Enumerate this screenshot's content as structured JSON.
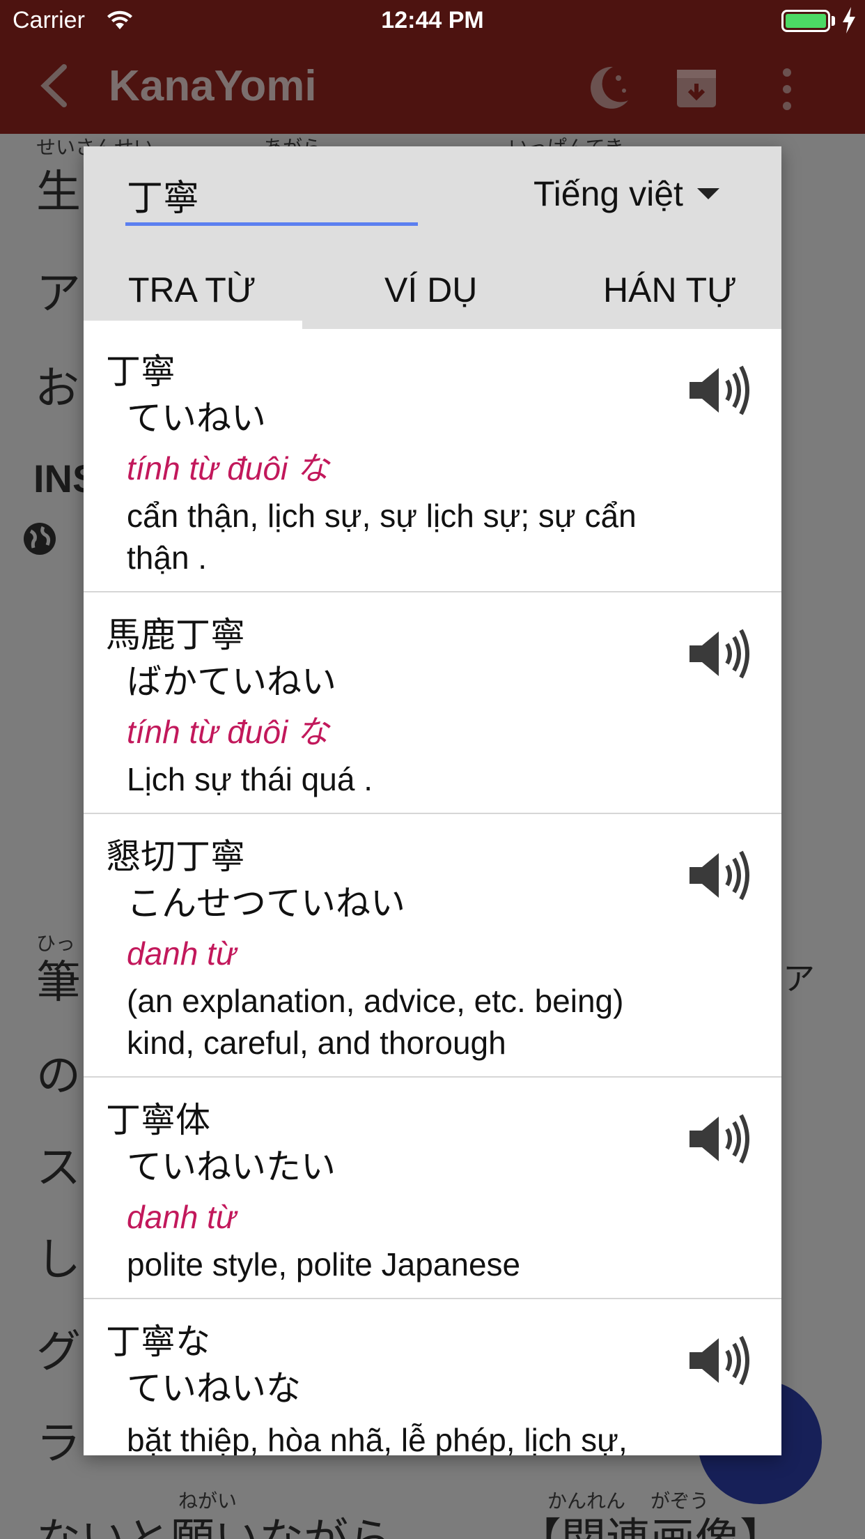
{
  "status_bar": {
    "carrier": "Carrier",
    "time": "12:44 PM"
  },
  "app_bar": {
    "title": "KanaYomi",
    "icons": [
      "back-icon",
      "moon-icon",
      "archive-icon",
      "more-icon"
    ]
  },
  "background": {
    "ruby_top": [
      "せいさんせい",
      "あがら",
      "いっぱんてき"
    ],
    "lines": [
      "生",
      "ア",
      "お",
      "筆",
      "の",
      "ス",
      "し",
      "グ",
      "ラ",
      "ないと願いながら",
      "【関連画像】"
    ],
    "ins_label": "INS",
    "ruby_hikku": "ひっ",
    "ruby_negai": "ねがい",
    "ruby_kanren": "かんれん",
    "ruby_gazou": "がぞう",
    "right_fragment": "ア"
  },
  "dialog": {
    "search": {
      "value": "丁寧"
    },
    "language": {
      "selected": "Tiếng việt"
    },
    "tabs": [
      "TRA TỪ",
      "VÍ DỤ",
      "HÁN TỰ"
    ],
    "active_tab": "TRA TỪ",
    "results": [
      {
        "word": "丁寧",
        "reading": "ていねい",
        "pos": "tính từ đuôi な",
        "meaning": "cẩn thận, lịch sự, sự lịch sự; sự cẩn thận ."
      },
      {
        "word": "馬鹿丁寧",
        "reading": "ばかていねい",
        "pos": "tính từ đuôi な",
        "meaning": "Lịch sự thái quá ."
      },
      {
        "word": "懇切丁寧",
        "reading": "こんせつていねい",
        "pos": "danh từ",
        "meaning": "(an explanation, advice, etc. being) kind, careful, and thorough"
      },
      {
        "word": "丁寧体",
        "reading": "ていねいたい",
        "pos": "danh từ",
        "meaning": "polite style, polite Japanese"
      },
      {
        "word": "丁寧な",
        "reading": "ていねいな",
        "pos": "",
        "meaning": "bặt thiệp, hòa nhã, lễ phép, lịch sự, nhã..."
      }
    ]
  },
  "colors": {
    "app_bar": "#4d1310",
    "pos_text": "#c2185b",
    "input_underline": "#5b7ff0",
    "fab": "#172058"
  }
}
